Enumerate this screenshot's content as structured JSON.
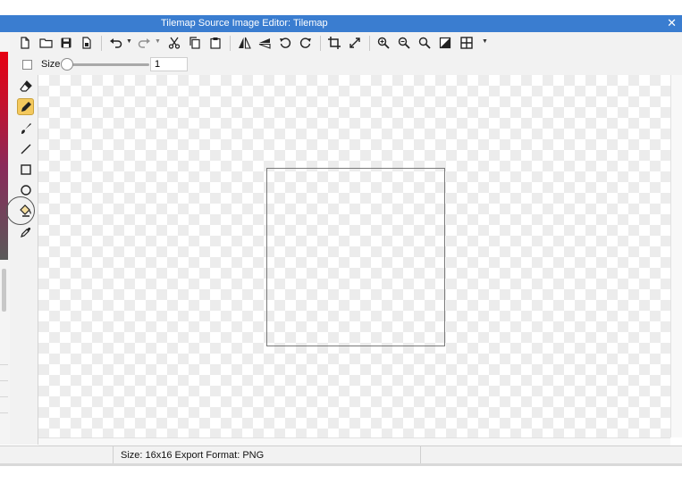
{
  "window": {
    "title": "Tilemap Source Image Editor: Tilemap",
    "close_glyph": "✕"
  },
  "toolbar": {
    "icons": [
      "new-file-icon",
      "open-folder-icon",
      "save-icon",
      "save-as-icon",
      "undo-icon",
      "redo-icon",
      "cut-icon",
      "copy-icon",
      "paste-icon",
      "flip-horizontal-icon",
      "flip-vertical-icon",
      "rotate-left-icon",
      "rotate-right-icon",
      "crop-icon",
      "resize-icon",
      "zoom-in-icon",
      "zoom-out-icon",
      "zoom-fit-icon",
      "background-color-icon",
      "grid-icon"
    ]
  },
  "size_control": {
    "label": "Size",
    "value": "1",
    "slider_fraction": 0.0
  },
  "tools": [
    "eraser-icon",
    "pencil-icon",
    "brush-icon",
    "line-icon",
    "rectangle-icon",
    "circle-icon",
    "fill-bucket-icon",
    "eyedropper-icon"
  ],
  "active_tool": "pencil-icon",
  "status": {
    "text": "Size: 16x16  Export Format: PNG"
  },
  "colors": {
    "titlebar": "#3a7dd0",
    "active_tool": "#f4c95d",
    "palette_top": "#e60012"
  }
}
